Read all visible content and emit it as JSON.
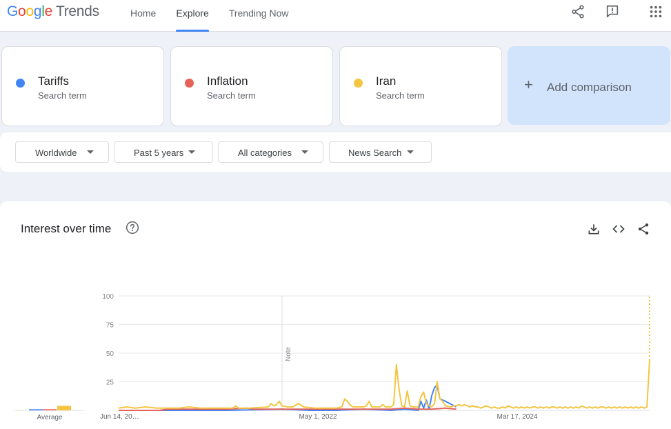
{
  "header": {
    "logo": {
      "part1": "G",
      "part2": "o",
      "part3": "o",
      "part4": "g",
      "part5": "l",
      "part6": "e",
      "product": "Trends"
    },
    "nav": [
      {
        "label": "Home",
        "active": false
      },
      {
        "label": "Explore",
        "active": true
      },
      {
        "label": "Trending Now",
        "active": false
      }
    ],
    "icons": [
      "share-icon",
      "feedback-icon",
      "apps-grid-icon"
    ]
  },
  "comparison": {
    "terms": [
      {
        "term": "Tariffs",
        "sub": "Search term",
        "color": "#4285f4"
      },
      {
        "term": "Inflation",
        "sub": "Search term",
        "color": "#e66359"
      },
      {
        "term": "Iran",
        "sub": "Search term",
        "color": "#f4c542"
      }
    ],
    "add_label": "Add comparison"
  },
  "filters": [
    {
      "label": "Worldwide"
    },
    {
      "label": "Past 5 years"
    },
    {
      "label": "All categories"
    },
    {
      "label": "News Search"
    }
  ],
  "panel": {
    "title": "Interest over time",
    "icons": [
      "help-icon",
      "download-icon",
      "embed-icon",
      "share-icon"
    ]
  },
  "chart_data": {
    "type": "line",
    "title": "Interest over time",
    "xlabel": "",
    "ylabel": "",
    "ylim": [
      0,
      100
    ],
    "yticks": [
      25,
      50,
      75,
      100
    ],
    "xtick_labels": [
      "Jun 14, 20…",
      "May 1, 2022",
      "Mar 17, 2024"
    ],
    "note_label": "Note",
    "average_label": "Average",
    "averages": [
      {
        "name": "Tariffs",
        "value": 1
      },
      {
        "name": "Inflation",
        "value": 1
      },
      {
        "name": "Iran",
        "value": 4
      }
    ],
    "series": [
      {
        "name": "Tariffs",
        "color": "#4285f4",
        "points": [
          [
            0,
            0
          ],
          [
            40,
            0
          ],
          [
            60,
            1
          ],
          [
            70,
            0
          ],
          [
            80,
            0
          ],
          [
            90,
            1
          ],
          [
            100,
            0
          ],
          [
            105,
            1
          ],
          [
            110,
            0
          ],
          [
            111,
            8
          ],
          [
            112,
            2
          ],
          [
            113,
            9
          ],
          [
            114,
            1
          ],
          [
            115,
            13
          ],
          [
            116,
            20
          ],
          [
            117,
            22
          ],
          [
            118,
            10
          ],
          [
            120,
            8
          ],
          [
            124,
            3
          ]
        ]
      },
      {
        "name": "Inflation",
        "color": "#e66359",
        "points": [
          [
            0,
            0
          ],
          [
            15,
            0
          ],
          [
            18,
            1
          ],
          [
            25,
            1
          ],
          [
            35,
            1
          ],
          [
            40,
            1
          ],
          [
            47,
            2
          ],
          [
            50,
            1
          ],
          [
            55,
            1
          ],
          [
            60,
            1
          ],
          [
            70,
            1
          ],
          [
            80,
            1
          ],
          [
            90,
            1
          ],
          [
            100,
            1
          ],
          [
            105,
            2
          ],
          [
            110,
            1
          ],
          [
            115,
            1
          ],
          [
            120,
            2
          ],
          [
            124,
            1
          ]
        ]
      },
      {
        "name": "Iran",
        "color": "#f4c542",
        "points": [
          [
            0,
            2
          ],
          [
            3,
            3
          ],
          [
            6,
            2
          ],
          [
            10,
            3
          ],
          [
            14,
            2
          ],
          [
            18,
            2
          ],
          [
            22,
            2
          ],
          [
            26,
            3
          ],
          [
            30,
            2
          ],
          [
            34,
            2
          ],
          [
            38,
            2
          ],
          [
            42,
            2
          ],
          [
            43,
            4
          ],
          [
            44,
            2
          ],
          [
            48,
            2
          ],
          [
            55,
            3
          ],
          [
            56,
            6
          ],
          [
            57,
            4
          ],
          [
            58,
            5
          ],
          [
            59,
            8
          ],
          [
            60,
            4
          ],
          [
            62,
            3
          ],
          [
            64,
            3
          ],
          [
            66,
            6
          ],
          [
            68,
            3
          ],
          [
            72,
            2
          ],
          [
            80,
            2
          ],
          [
            82,
            3
          ],
          [
            83,
            10
          ],
          [
            84,
            8
          ],
          [
            85,
            5
          ],
          [
            86,
            3
          ],
          [
            88,
            3
          ],
          [
            90,
            3
          ],
          [
            91,
            4
          ],
          [
            92,
            8
          ],
          [
            93,
            3
          ],
          [
            94,
            3
          ],
          [
            96,
            3
          ],
          [
            97,
            5
          ],
          [
            98,
            3
          ],
          [
            100,
            3
          ],
          [
            101,
            5
          ],
          [
            102,
            40
          ],
          [
            103,
            18
          ],
          [
            104,
            4
          ],
          [
            105,
            3
          ],
          [
            106,
            17
          ],
          [
            107,
            4
          ],
          [
            108,
            3
          ],
          [
            110,
            3
          ],
          [
            111,
            12
          ],
          [
            112,
            16
          ],
          [
            113,
            6
          ],
          [
            114,
            4
          ],
          [
            115,
            3
          ],
          [
            116,
            6
          ],
          [
            117,
            25
          ],
          [
            118,
            10
          ],
          [
            119,
            8
          ],
          [
            120,
            4
          ],
          [
            122,
            3
          ],
          [
            123,
            4
          ],
          [
            124,
            4
          ],
          [
            125,
            5
          ],
          [
            126,
            4
          ],
          [
            127,
            5
          ],
          [
            128,
            4
          ],
          [
            129,
            3
          ],
          [
            130,
            4
          ],
          [
            131,
            3
          ],
          [
            132,
            3
          ],
          [
            133,
            2
          ],
          [
            134,
            3
          ],
          [
            135,
            4
          ],
          [
            136,
            3
          ],
          [
            137,
            2
          ],
          [
            138,
            3
          ],
          [
            139,
            2
          ],
          [
            140,
            2
          ],
          [
            141,
            3
          ],
          [
            142,
            2
          ],
          [
            143,
            4
          ],
          [
            144,
            3
          ],
          [
            145,
            2
          ],
          [
            146,
            3
          ],
          [
            147,
            2
          ],
          [
            148,
            3
          ],
          [
            149,
            2
          ],
          [
            150,
            3
          ],
          [
            151,
            2
          ],
          [
            152,
            3
          ],
          [
            153,
            3
          ],
          [
            154,
            2
          ],
          [
            155,
            3
          ],
          [
            156,
            2
          ],
          [
            157,
            3
          ],
          [
            158,
            2
          ],
          [
            159,
            3
          ],
          [
            160,
            3
          ],
          [
            161,
            2
          ],
          [
            162,
            3
          ],
          [
            163,
            2
          ],
          [
            164,
            3
          ],
          [
            165,
            2
          ],
          [
            166,
            3
          ],
          [
            167,
            2
          ],
          [
            168,
            3
          ],
          [
            169,
            2
          ],
          [
            170,
            4
          ],
          [
            171,
            3
          ],
          [
            172,
            2
          ],
          [
            173,
            3
          ],
          [
            174,
            2
          ],
          [
            175,
            3
          ],
          [
            176,
            2
          ],
          [
            177,
            3
          ],
          [
            178,
            3
          ],
          [
            179,
            2
          ],
          [
            180,
            3
          ],
          [
            181,
            2
          ],
          [
            182,
            3
          ],
          [
            183,
            2
          ],
          [
            184,
            3
          ],
          [
            185,
            2
          ],
          [
            186,
            3
          ],
          [
            187,
            2
          ],
          [
            188,
            3
          ],
          [
            189,
            2
          ],
          [
            190,
            3
          ],
          [
            191,
            2
          ],
          [
            192,
            3
          ],
          [
            193,
            2
          ],
          [
            194,
            3
          ],
          [
            195,
            44
          ]
        ],
        "partial_to": 100
      }
    ]
  }
}
